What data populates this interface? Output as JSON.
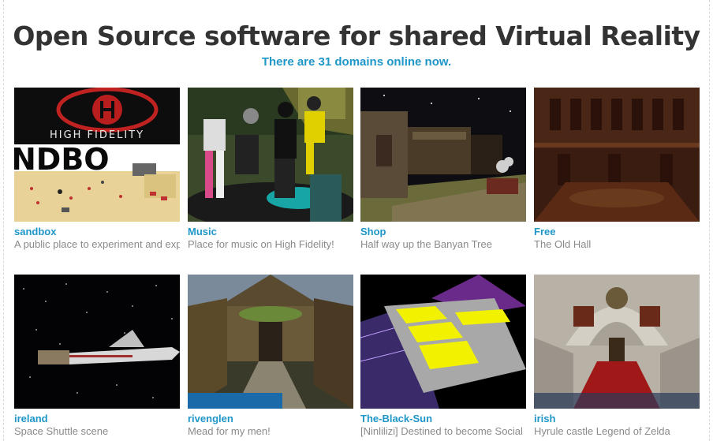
{
  "hero": {
    "title": "Open Source software for shared Virtual Reality",
    "subtitle": "There are 31 domains online now."
  },
  "domains": [
    {
      "name": "sandbox",
      "description": "A public place to experiment and explore"
    },
    {
      "name": "Music",
      "description": "Place for music on High Fidelity!"
    },
    {
      "name": "Shop",
      "description": "Half way up the Banyan Tree"
    },
    {
      "name": "Free",
      "description": "The Old Hall"
    },
    {
      "name": "ireland",
      "description": "Space Shuttle scene"
    },
    {
      "name": "rivenglen",
      "description": "Mead for my men!"
    },
    {
      "name": "The-Black-Sun",
      "description": "[Ninlilizi] Destined to become Social"
    },
    {
      "name": "irish",
      "description": "Hyrule castle Legend of Zelda"
    }
  ],
  "thumbnail_text": {
    "sandbox_logo": "HIGH FIDELITY",
    "sandbox_sign": "NDBO"
  },
  "colors": {
    "title": "#333333",
    "link": "#1e96c8",
    "description": "#8a8a8a"
  }
}
